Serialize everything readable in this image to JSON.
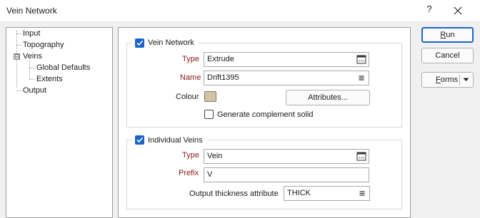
{
  "window": {
    "title": "Vein Network",
    "help_glyph": "?"
  },
  "tree": {
    "items": [
      {
        "label": "Input"
      },
      {
        "label": "Topography"
      },
      {
        "label": "Veins",
        "expander": "⊟"
      },
      {
        "label": "Global Defaults"
      },
      {
        "label": "Extents"
      },
      {
        "label": "Output",
        "selected": true
      }
    ]
  },
  "vein_network": {
    "group_label": "Vein Network",
    "checked": true,
    "type_label": "Type",
    "type_value": "Extrude",
    "name_label": "Name",
    "name_value": "Drift1395",
    "colour_label": "Colour",
    "colour_value": "#d3c3a1",
    "attributes_button": "Attributes...",
    "complement_label": "Generate complement solid",
    "complement_checked": false
  },
  "individual_veins": {
    "group_label": "Individual Veins",
    "checked": true,
    "type_label": "Type",
    "type_value": "Vein",
    "prefix_label": "Prefix",
    "prefix_value": "V",
    "thickness_label": "Output thickness attribute",
    "thickness_value": "THICK"
  },
  "buttons": {
    "run_rest": "un",
    "run_accel": "R",
    "cancel": "Cancel",
    "forms_accel": "F",
    "forms_rest": "orms"
  },
  "colors": {
    "accent": "#1a66c8",
    "required_label": "#8b1a1a",
    "swatch": "#d3c3a1"
  }
}
